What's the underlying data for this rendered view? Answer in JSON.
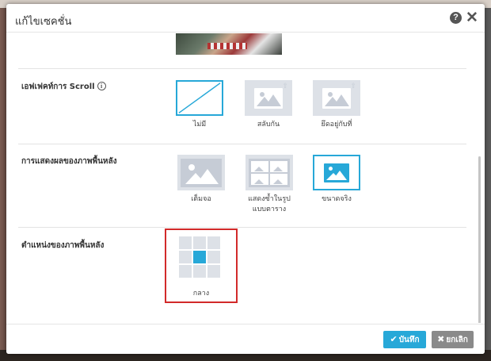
{
  "dialog": {
    "title": "แก้ไขเซคชั่น",
    "help_icon": "question-circle-icon",
    "close_icon": "close-icon"
  },
  "sections": {
    "scroll_effect": {
      "label": "เอฟเฟคท์การ Scroll",
      "info_icon": "info-circle-icon",
      "options": [
        {
          "label": "ไม่มี",
          "selected": true,
          "icon": "none-diagonal-icon"
        },
        {
          "label": "สลับกัน",
          "selected": false,
          "icon": "image-parallax-icon"
        },
        {
          "label": "ยึดอยู่กับที่",
          "selected": false,
          "icon": "image-fixed-icon"
        }
      ]
    },
    "bg_display": {
      "label": "การแสดงผลของภาพพื้นหลัง",
      "options": [
        {
          "label": "เต็มจอ",
          "selected": false,
          "icon": "image-fill-icon"
        },
        {
          "label": "แสดงซ้ำในรูปแบบตาราง",
          "label_line1": "แสดงซ้ำในรูป",
          "label_line2": "แบบตาราง",
          "selected": false,
          "icon": "image-tile-icon"
        },
        {
          "label": "ขนาดจริง",
          "selected": true,
          "icon": "image-actual-size-icon"
        }
      ]
    },
    "bg_position": {
      "label": "ตำแหน่งของภาพพื้นหลัง",
      "selected_cell": 4,
      "value_label": "กลาง"
    }
  },
  "footer": {
    "save_label": "บันทึก",
    "cancel_label": "ยกเลิก"
  },
  "colors": {
    "accent": "#27a8d8",
    "highlight_border": "#d22a2a",
    "cancel_gray": "#8a8a8a"
  }
}
